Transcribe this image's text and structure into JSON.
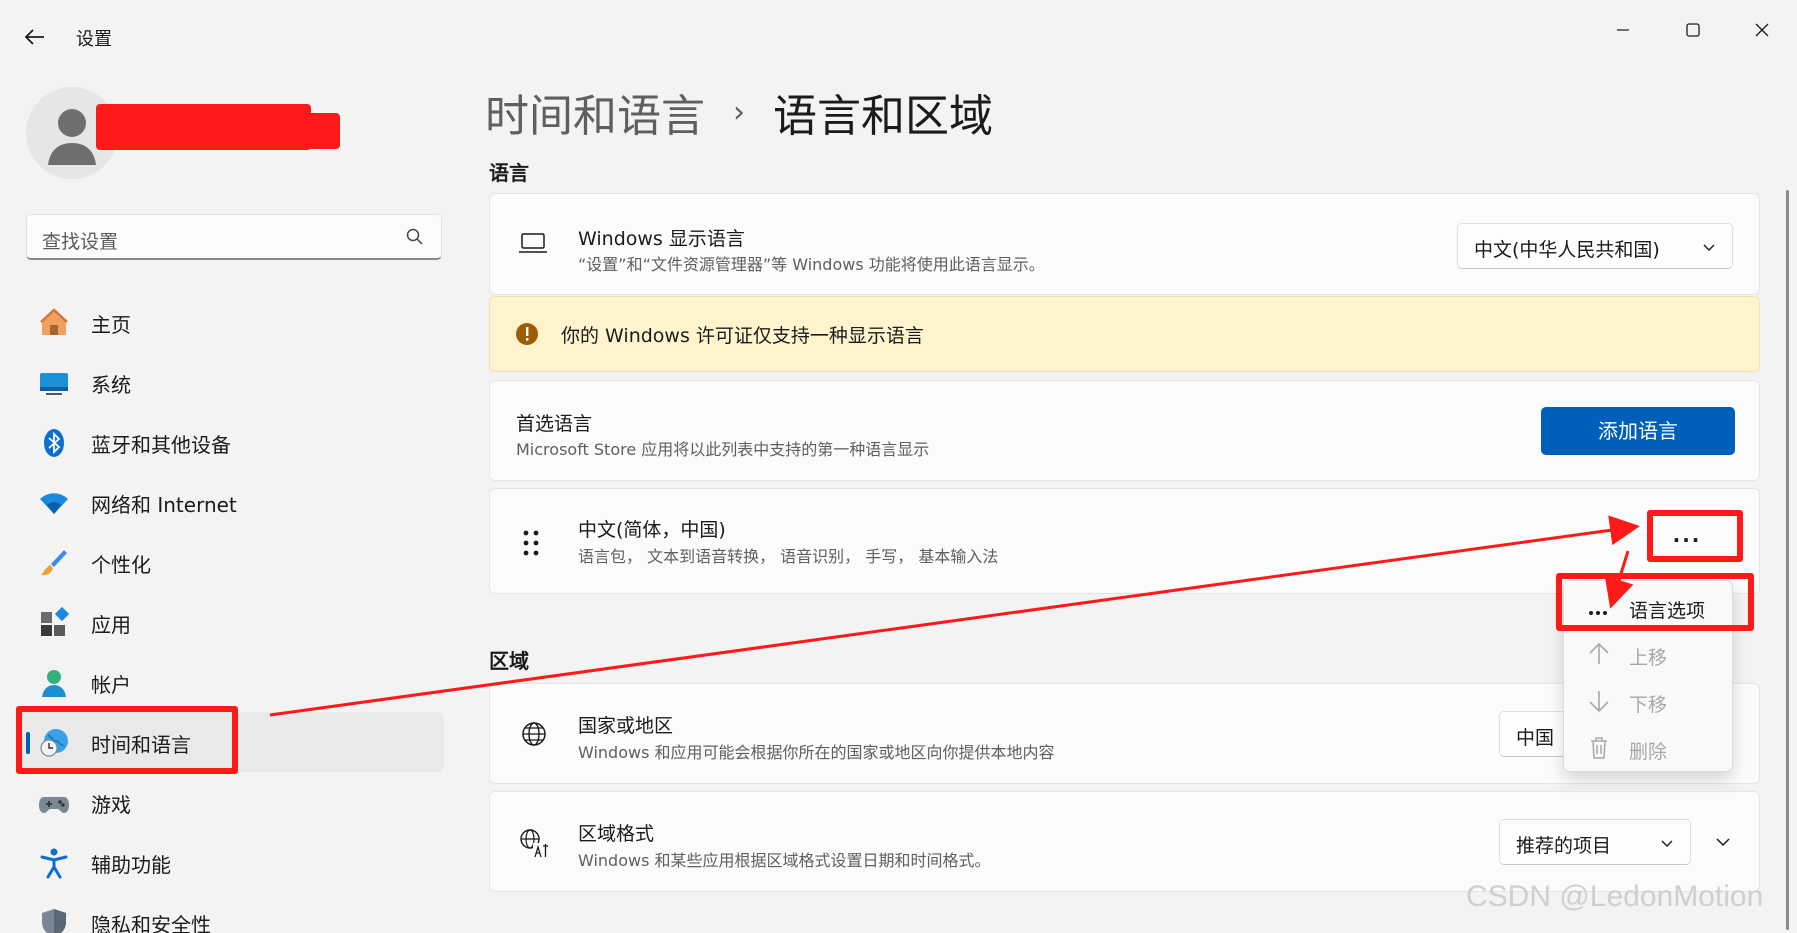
{
  "window": {
    "title": "设置",
    "controls": {
      "minimize": "minimize-icon",
      "maximize": "maximize-icon",
      "close": "close-icon"
    }
  },
  "sidebar": {
    "search_placeholder": "查找设置",
    "items": [
      {
        "label": "主页",
        "icon": "home-icon"
      },
      {
        "label": "系统",
        "icon": "system-icon"
      },
      {
        "label": "蓝牙和其他设备",
        "icon": "bluetooth-icon"
      },
      {
        "label": "网络和 Internet",
        "icon": "wifi-icon"
      },
      {
        "label": "个性化",
        "icon": "brush-icon"
      },
      {
        "label": "应用",
        "icon": "apps-icon"
      },
      {
        "label": "帐户",
        "icon": "account-icon"
      },
      {
        "label": "时间和语言",
        "icon": "globe-clock-icon",
        "active": true
      },
      {
        "label": "游戏",
        "icon": "gamepad-icon"
      },
      {
        "label": "辅助功能",
        "icon": "accessibility-icon"
      },
      {
        "label": "隐私和安全性",
        "icon": "shield-icon"
      }
    ]
  },
  "breadcrumb": {
    "parent": "时间和语言",
    "separator": "›",
    "current": "语言和区域"
  },
  "language_section": {
    "title": "语言",
    "display_language": {
      "title": "Windows 显示语言",
      "description": "“设置”和“文件资源管理器”等 Windows 功能将使用此语言显示。",
      "value": "中文(中华人民共和国)"
    },
    "warning": "你的 Windows 许可证仅支持一种显示语言",
    "preferred": {
      "title": "首选语言",
      "description": "Microsoft Store 应用将以此列表中支持的第一种语言显示",
      "button": "添加语言"
    },
    "language_item": {
      "title": "中文(简体，中国)",
      "description": "语言包，  文本到语音转换，  语音识别，  手写，  基本输入法",
      "more": "..."
    }
  },
  "context_menu": {
    "items": [
      {
        "label": "语言选项",
        "icon": "more-icon",
        "disabled": false
      },
      {
        "label": "上移",
        "icon": "arrow-up-icon",
        "disabled": true
      },
      {
        "label": "下移",
        "icon": "arrow-down-icon",
        "disabled": true
      },
      {
        "label": "删除",
        "icon": "trash-icon",
        "disabled": true
      }
    ]
  },
  "region_section": {
    "title": "区域",
    "country": {
      "title": "国家或地区",
      "description": "Windows 和应用可能会根据你所在的国家或地区向你提供本地内容",
      "value": "中国"
    },
    "format": {
      "title": "区域格式",
      "description": "Windows 和某些应用根据区域格式设置日期和时间格式。",
      "value": "推荐的项目"
    }
  },
  "annotations": {
    "highlight_color": "#ff1a1a"
  },
  "watermark": "CSDN @LedonMotion",
  "colors": {
    "accent": "#005fb8",
    "warning_bg": "#fff4ce",
    "warning_icon": "#9d5d00"
  }
}
